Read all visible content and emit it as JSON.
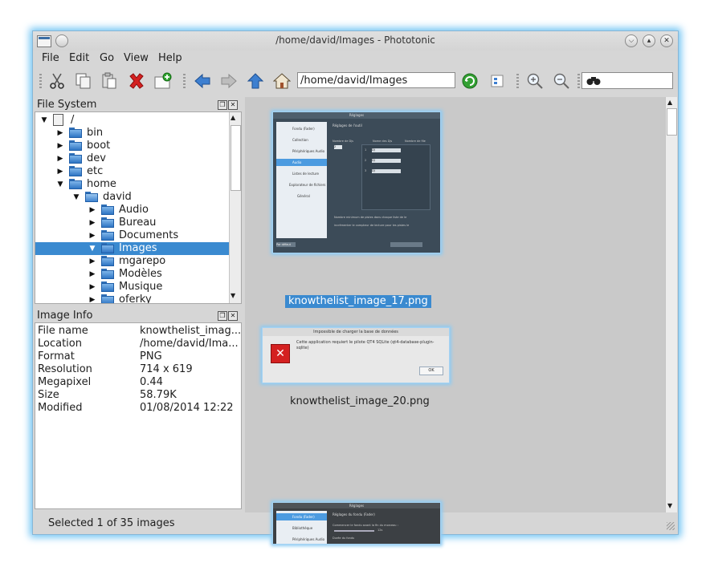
{
  "window": {
    "title": "/home/david/Images - Phototonic"
  },
  "menu": [
    "File",
    "Edit",
    "Go",
    "View",
    "Help"
  ],
  "toolbar": {
    "path_value": "/home/david/Images",
    "icons": [
      "cut-icon",
      "copy-icon",
      "paste-icon",
      "delete-icon",
      "new-folder-icon",
      "back-icon",
      "forward-icon",
      "up-icon",
      "home-icon",
      "refresh-icon",
      "thumbnail-view-icon",
      "zoom-in-icon",
      "zoom-out-icon",
      "binoculars-icon"
    ],
    "search_value": ""
  },
  "file_system": {
    "title": "File System",
    "items": [
      {
        "label": "/",
        "depth": 0,
        "expanded": true,
        "icon": "drive-icon"
      },
      {
        "label": "bin",
        "depth": 1,
        "expanded": false,
        "icon": "folder-icon"
      },
      {
        "label": "boot",
        "depth": 1,
        "expanded": false,
        "icon": "folder-icon"
      },
      {
        "label": "dev",
        "depth": 1,
        "expanded": false,
        "icon": "folder-icon"
      },
      {
        "label": "etc",
        "depth": 1,
        "expanded": false,
        "icon": "folder-icon"
      },
      {
        "label": "home",
        "depth": 1,
        "expanded": true,
        "icon": "folder-icon"
      },
      {
        "label": "david",
        "depth": 2,
        "expanded": true,
        "icon": "home-folder-icon"
      },
      {
        "label": "Audio",
        "depth": 3,
        "expanded": false,
        "icon": "folder-icon"
      },
      {
        "label": "Bureau",
        "depth": 3,
        "expanded": false,
        "icon": "folder-icon"
      },
      {
        "label": "Documents",
        "depth": 3,
        "expanded": false,
        "icon": "folder-icon"
      },
      {
        "label": "Images",
        "depth": 3,
        "expanded": true,
        "icon": "folder-icon",
        "selected": true
      },
      {
        "label": "mgarepo",
        "depth": 3,
        "expanded": false,
        "icon": "folder-icon"
      },
      {
        "label": "Modèles",
        "depth": 3,
        "expanded": false,
        "icon": "folder-icon"
      },
      {
        "label": "Musique",
        "depth": 3,
        "expanded": false,
        "icon": "folder-icon"
      },
      {
        "label": "oferky",
        "depth": 3,
        "expanded": false,
        "icon": "folder-icon"
      }
    ]
  },
  "image_info": {
    "title": "Image Info",
    "rows": [
      {
        "key": "File name",
        "value": "knowthelist_imag..."
      },
      {
        "key": "Location",
        "value": "/home/david/Ima..."
      },
      {
        "key": "Format",
        "value": "PNG"
      },
      {
        "key": "Resolution",
        "value": "714 x 619"
      },
      {
        "key": "Megapixel",
        "value": "0.44"
      },
      {
        "key": "Size",
        "value": "58.79K"
      },
      {
        "key": "Modified",
        "value": "01/08/2014 12:22"
      }
    ]
  },
  "thumbnails": [
    {
      "caption": "knowthelist_image_17.png",
      "selected": true,
      "titlebar": "Réglages",
      "header": "Réglages de l'outil",
      "sidebar": [
        "Fondu (Fader)",
        "Collection",
        "Périphériques Audio",
        "Audio",
        "Listes de lecture",
        "Explorateur de fichiers",
        "Général"
      ],
      "columns": [
        "Nombre de Djs",
        "Nome des Djs",
        "Nombre de file"
      ],
      "rows": [
        "1",
        "2",
        "3"
      ],
      "row_value": "DJ",
      "spin_value": "2",
      "note1": "Nombre minimum de pistes dans chaque liste de le",
      "note2": "incrémenter le compteur de lecture pour les pistes le",
      "bottom_left": "Par défaut"
    },
    {
      "caption": "knowthelist_image_20.png",
      "selected": false,
      "title": "Impossible de charger la base de données",
      "message": "Cette application requiert le pilote QT4 SQLite (qt4-database-plugin-sqlite)",
      "ok": "OK"
    },
    {
      "caption": "",
      "selected": false,
      "titlebar": "Réglages",
      "header": "Réglages du fondu (Fader)",
      "sidebar": [
        "Fondu (Fader)",
        "Bibliothèque",
        "Périphériques Audio"
      ],
      "line1": "Commencer le fondu avant la fin du morceau :",
      "slider_value": "12s",
      "line2": "Durée du fondu"
    }
  ],
  "status": {
    "text": "Selected 1 of 35 images"
  },
  "colors": {
    "selection": "#3a8ad0",
    "focus_glow": "#6fc3f3",
    "thumb_bg": "#c9c9c9"
  }
}
